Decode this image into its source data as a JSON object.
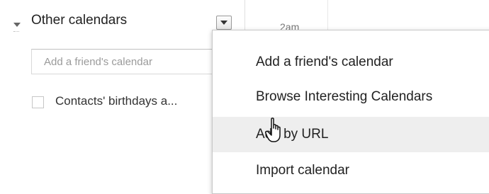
{
  "sidebar": {
    "section_title": "Other calendars",
    "friend_input": {
      "value": "",
      "placeholder": "Add a friend's calendar"
    },
    "calendars": [
      {
        "label": "Contacts' birthdays a...",
        "checked": false
      }
    ]
  },
  "grid": {
    "time_label": "2am"
  },
  "menu": {
    "items": [
      {
        "label": "Add a friend's calendar"
      },
      {
        "label": "Browse Interesting Calendars"
      },
      {
        "label": "Add by URL",
        "highlighted": true
      },
      {
        "label": "Import calendar"
      }
    ]
  },
  "colors": {
    "highlight": "#eeeeee",
    "border": "#c8c8c8"
  },
  "icons": {
    "toggle": "triangle-down-icon",
    "menu": "chevron-down-icon",
    "cursor": "hand-pointer-icon"
  }
}
